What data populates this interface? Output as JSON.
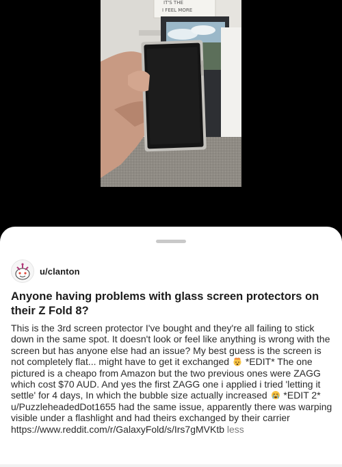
{
  "post": {
    "author": "u/clanton",
    "title": "Anyone having problems with glass screen protectors on their Z Fold 8?",
    "body_part1": "This is the 3rd screen protector I've bought and they're all failing to stick down in the same spot. It doesn't look or feel like anything is wrong with the screen but has anyone else had an issue? My best guess is the screen is not completely flat... might have to get it exchanged ",
    "body_part2": " *EDIT* The one pictured is a cheapo from Amazon but the two previous ones were ZAGG which cost $70 AUD. And yes the first ZAGG one i applied i tried 'letting it settle' for 4 days, In which the bubble size actually increased ",
    "body_part3": " *EDIT 2* u/PuzzleheadedDot1655 had the same issue, apparently there was warping visible under a flashlight and had theirs exchanged by their carrier https://www.reddit.com/r/GalaxyFold/s/Irs7gMVKtb ",
    "less_label": "less"
  },
  "photo": {
    "poster_text_line1": "IT'S THE",
    "poster_text_line2": "I FEEL MORE"
  },
  "icons": {
    "emoji_1": "exploding-head-emoji-icon",
    "emoji_2": "crying-face-emoji-icon",
    "avatar": "snoo-avatar-icon"
  },
  "colors": {
    "sheet_background": "#ffffff",
    "text_primary": "#1c1c1c",
    "text_muted": "#7c7c7c",
    "backdrop": "#000000"
  }
}
